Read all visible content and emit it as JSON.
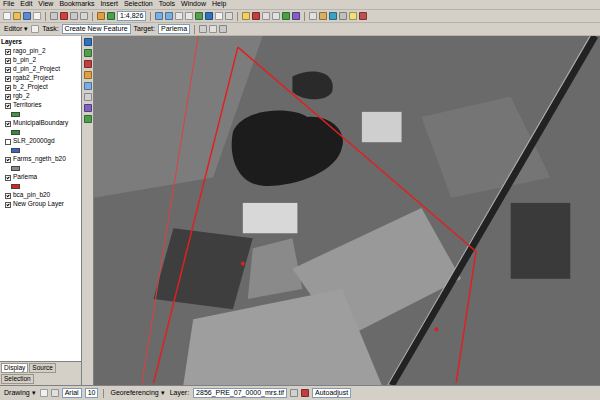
{
  "menu": [
    "File",
    "Edit",
    "View",
    "Bookmarks",
    "Insert",
    "Selection",
    "Tools",
    "Window",
    "Help"
  ],
  "toolbar": {
    "scale": "1:4,826"
  },
  "editor": {
    "label": "Editor ▾",
    "task_label": "Task:",
    "task": "Create New Feature",
    "target_label": "Target:",
    "target": "Parlema"
  },
  "toc": {
    "title": "Layers",
    "items": [
      {
        "kind": "layer",
        "label": "rago_pin_2",
        "checked": true
      },
      {
        "kind": "layer",
        "label": "b_pin_2",
        "checked": true
      },
      {
        "kind": "layer",
        "label": "d_pin_2_Project",
        "checked": true
      },
      {
        "kind": "layer",
        "label": "rgab2_Project",
        "checked": true
      },
      {
        "kind": "layer",
        "label": "b_2_Project",
        "checked": true
      },
      {
        "kind": "layer",
        "label": "rgb_2",
        "checked": true
      },
      {
        "kind": "layer",
        "label": "Territories",
        "checked": true
      },
      {
        "kind": "swatch",
        "color": "#3a9a3a"
      },
      {
        "kind": "layer",
        "label": "MunicipalBoundary",
        "checked": true
      },
      {
        "kind": "swatch",
        "color": "#2f8f2f"
      },
      {
        "kind": "layer",
        "label": "SLR_20000gd",
        "checked": false
      },
      {
        "kind": "swatch",
        "color": "#3366cc"
      },
      {
        "kind": "layer",
        "label": "Farms_ngeth_b20",
        "checked": true
      },
      {
        "kind": "swatch",
        "color": "#8a8a8a"
      },
      {
        "kind": "layer",
        "label": "Parlema",
        "checked": true
      },
      {
        "kind": "swatch",
        "color": "#e02020"
      },
      {
        "kind": "layer",
        "label": "bca_pin_b20",
        "checked": true
      },
      {
        "kind": "layer",
        "label": "New Group Layer",
        "checked": true
      }
    ]
  },
  "toc_tabs": [
    {
      "label": "Display",
      "selected": true
    },
    {
      "label": "Source",
      "selected": false
    },
    {
      "label": "Selection",
      "selected": false
    }
  ],
  "bottom_bar": {
    "drawing": "Drawing ▾",
    "font": "Arial",
    "size": "10",
    "georef": "Georeferencing ▾",
    "layer_label": "Layer:",
    "layer": "2856_PRE_07_0000_mrs.tif",
    "adjust": "Autoadjust"
  }
}
